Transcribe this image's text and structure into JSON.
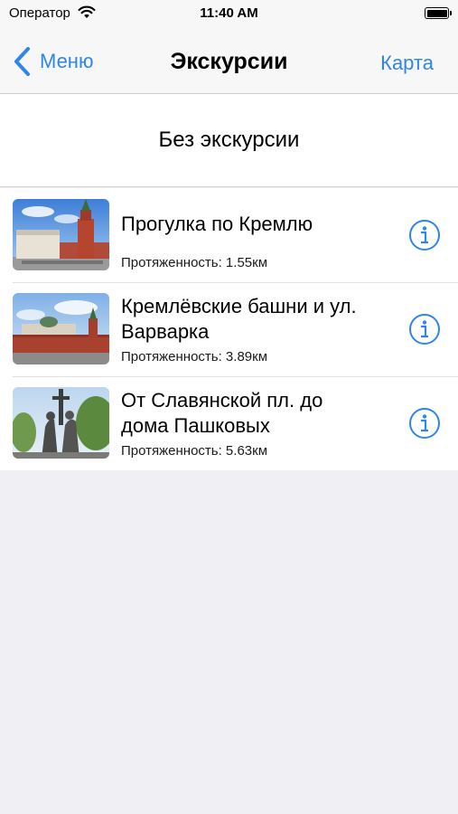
{
  "status_bar": {
    "carrier": "Оператор",
    "time": "11:40 AM"
  },
  "nav": {
    "back_label": "Меню",
    "title": "Экскурсии",
    "right_label": "Карта"
  },
  "no_tour": {
    "label": "Без экскурсии"
  },
  "tours": [
    {
      "title": "Прогулка по Кремлю",
      "length": "Протяженность: 1.55км",
      "thumbnail": "kremlin-tower-photo"
    },
    {
      "title": "Кремлёвские башни и ул. Варварка",
      "length": "Протяженность: 3.89км",
      "thumbnail": "kremlin-wall-photo"
    },
    {
      "title": "От Славянской пл. до дома Пашковых",
      "length": "Протяженность: 5.63км",
      "thumbnail": "monument-photo"
    }
  ],
  "colors": {
    "accent": "#2f86ea",
    "nav_background": "#f7f7f7",
    "page_background": "#efeff4"
  },
  "icons": {
    "back": "chevron-left-icon",
    "info": "info-circle-icon",
    "wifi": "wifi-icon",
    "battery": "battery-icon"
  }
}
